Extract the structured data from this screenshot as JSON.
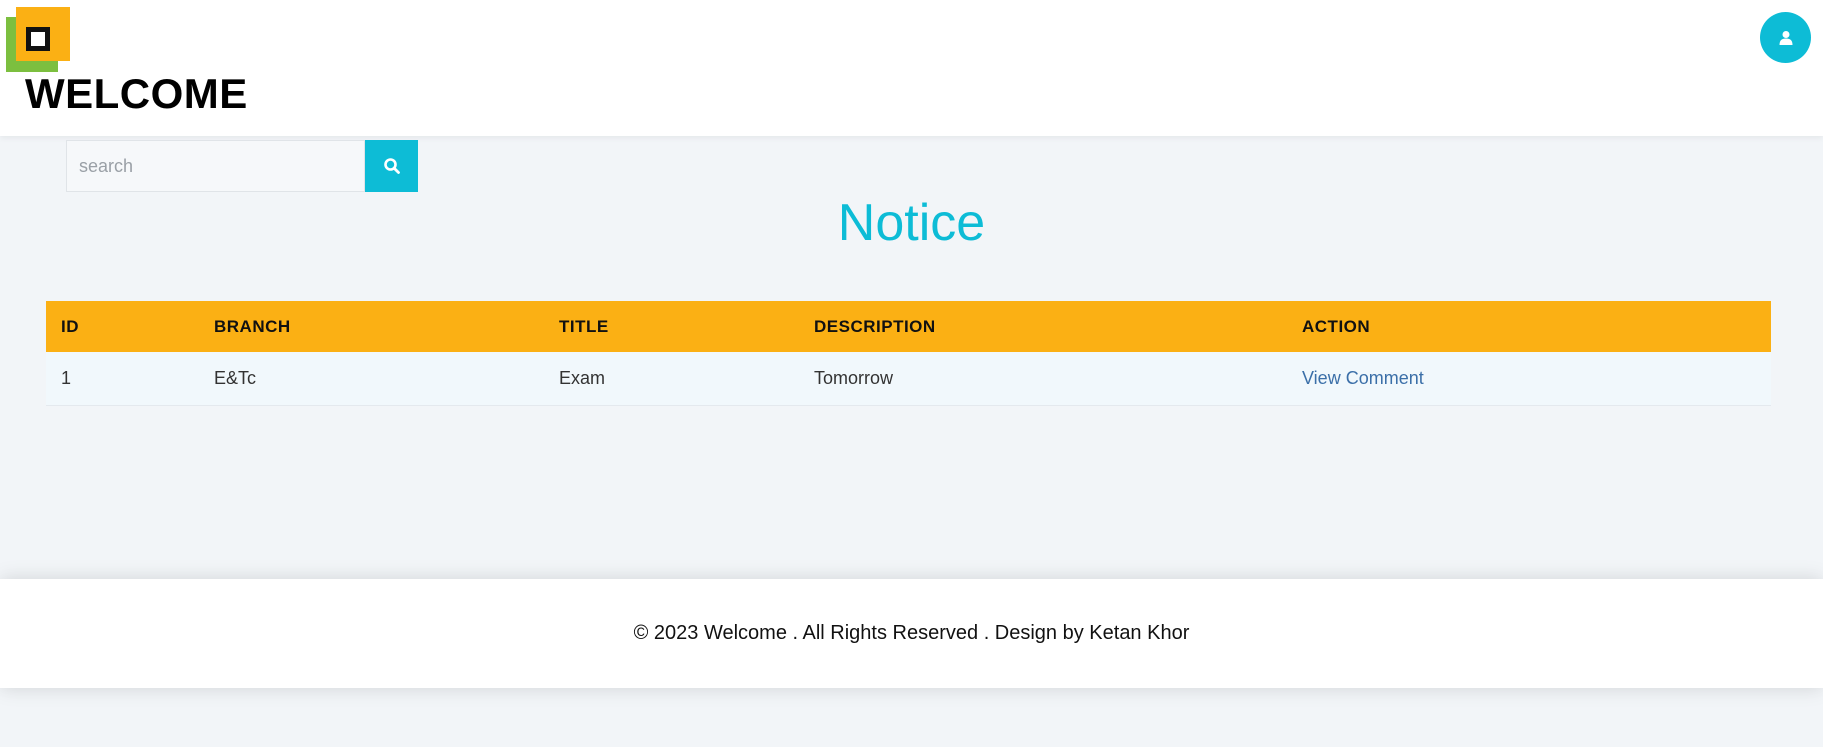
{
  "header": {
    "brand": "WELCOME"
  },
  "search": {
    "placeholder": "search"
  },
  "page": {
    "title": "Notice"
  },
  "table": {
    "columns": [
      "ID",
      "BRANCH",
      "TITLE",
      "DESCRIPTION",
      "ACTION"
    ],
    "rows": [
      {
        "id": "1",
        "branch": "E&Tc",
        "title": "Exam",
        "description": "Tomorrow",
        "action": "View Comment"
      }
    ]
  },
  "footer": {
    "text": "© 2023 Welcome . All Rights Reserved . Design by Ketan Khor"
  },
  "colors": {
    "accent": "#0dbcd6",
    "table_header": "#fbb014",
    "logo_green": "#7cbf3f",
    "link": "#3b6fa8"
  },
  "icons": {
    "search": "search-icon",
    "user": "user-icon",
    "logo": "logo-icon"
  }
}
